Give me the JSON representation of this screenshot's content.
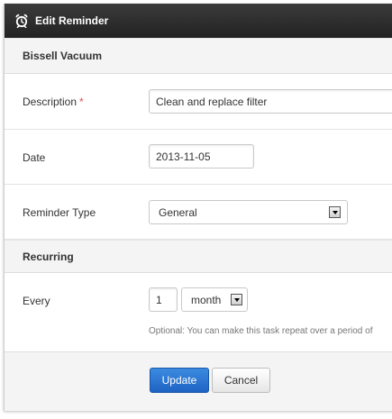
{
  "dialog": {
    "title": "Edit Reminder",
    "icon": "alarm-clock-icon"
  },
  "item": {
    "name": "Bissell Vacuum"
  },
  "form": {
    "description": {
      "label": "Description",
      "required_marker": "*",
      "value": "Clean and replace filter"
    },
    "date": {
      "label": "Date",
      "value": "2013-11-05"
    },
    "reminder_type": {
      "label": "Reminder Type",
      "selected": "General"
    }
  },
  "recurring": {
    "header": "Recurring",
    "every_label": "Every",
    "interval_value": "1",
    "unit_selected": "month",
    "hint": "Optional: You can make this task repeat over a period of"
  },
  "buttons": {
    "update": "Update",
    "cancel": "Cancel"
  },
  "colors": {
    "titlebar": "#2b2b2b",
    "primary": "#2a75d3",
    "required": "#d9534f"
  }
}
